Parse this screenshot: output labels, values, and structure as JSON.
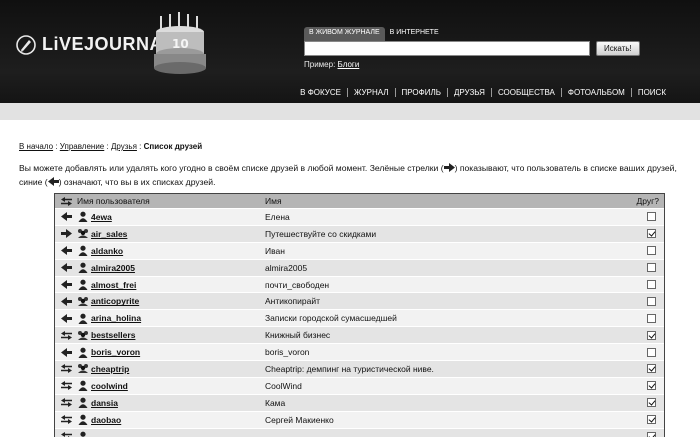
{
  "header": {
    "logo_text": "LiVEJOURNAL",
    "search_tabs": [
      "В ЖИВОМ ЖУРНАЛЕ",
      "В ИНТЕРНЕТЕ"
    ],
    "search_value": "",
    "search_button": "Искать!",
    "example_label": "Пример:",
    "example_link": "Блоги",
    "nav": [
      "В ФОКУСЕ",
      "ЖУРНАЛ",
      "ПРОФИЛЬ",
      "ДРУЗЬЯ",
      "СООБЩЕСТВА",
      "ФОТОАЛЬБОМ",
      "ПОИСК"
    ]
  },
  "breadcrumb": {
    "items": [
      "В начало",
      "Управление",
      "Друзья"
    ],
    "separator": ":",
    "current": "Список друзей"
  },
  "intro": {
    "part1": "Вы можете добавлять или удалять кого угодно в своём списке друзей в любой момент. Зелёные стрелки (",
    "part2": ") показывают, что пользователь в списке ваших друзей, синие (",
    "part3": ") означают, что вы в их списках друзей."
  },
  "table": {
    "headers": {
      "username": "Имя пользователя",
      "name": "Имя",
      "friend": "Друг?"
    },
    "rows": [
      {
        "dir": "in",
        "type": "user",
        "username": "4ewa",
        "name": "Елена",
        "friend": false
      },
      {
        "dir": "out",
        "type": "community",
        "username": "air_sales",
        "name": "Путешествуйте со скидками",
        "friend": true
      },
      {
        "dir": "in",
        "type": "user",
        "username": "aldanko",
        "name": "Иван",
        "friend": false
      },
      {
        "dir": "in",
        "type": "user",
        "username": "almira2005",
        "name": "almira2005",
        "friend": false
      },
      {
        "dir": "in",
        "type": "user",
        "username": "almost_frei",
        "name": "почти_свободен",
        "friend": false
      },
      {
        "dir": "in",
        "type": "community",
        "username": "anticopyrite",
        "name": "Антикопирайт",
        "friend": false
      },
      {
        "dir": "in",
        "type": "user",
        "username": "arina_holina",
        "name": "Записки городской сумасшедшей",
        "friend": false
      },
      {
        "dir": "both",
        "type": "community",
        "username": "bestsellers",
        "name": "Книжный бизнес",
        "friend": true
      },
      {
        "dir": "in",
        "type": "user",
        "username": "boris_voron",
        "name": "boris_voron",
        "friend": false
      },
      {
        "dir": "both",
        "type": "community",
        "username": "cheaptrip",
        "name": "Cheaptrip: демпинг на туристической ниве.",
        "friend": true
      },
      {
        "dir": "both",
        "type": "user",
        "username": "coolwind",
        "name": "CoolWind",
        "friend": true
      },
      {
        "dir": "both",
        "type": "user",
        "username": "dansia",
        "name": "Кама",
        "friend": true
      },
      {
        "dir": "both",
        "type": "user",
        "username": "daobao",
        "name": "Сергей Макиенко",
        "friend": true
      },
      {
        "dir": "both",
        "type": "user",
        "username": "",
        "name": "",
        "friend": true
      }
    ]
  }
}
